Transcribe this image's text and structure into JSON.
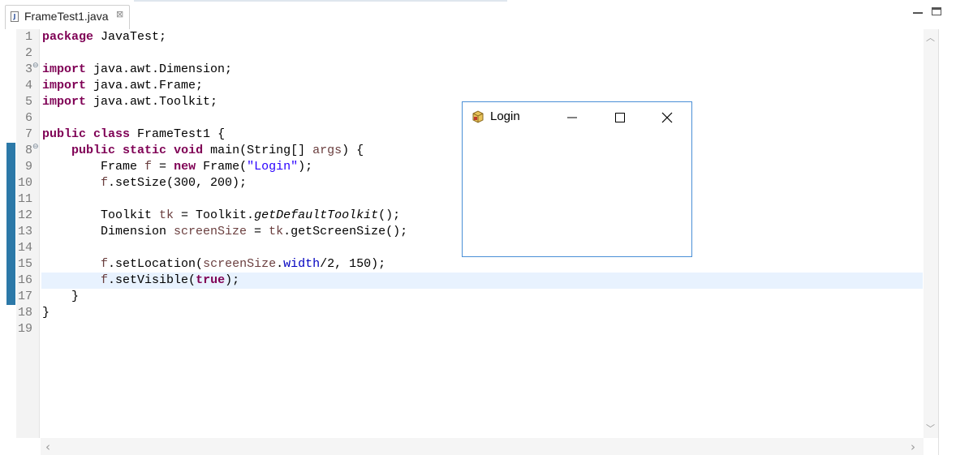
{
  "tab": {
    "title": "FrameTest1.java",
    "file_icon": "J",
    "close_glyph": "⊠"
  },
  "colors": {
    "keyword": "#7f0055",
    "string": "#2a00ff",
    "field": "#0000c0",
    "local_var": "#6a3e3e",
    "change_bar": "#2c79a8",
    "current_line": "#e8f2fe",
    "frame_border": "#4a8fd6"
  },
  "code": {
    "lines": [
      {
        "n": "1",
        "fold": "",
        "tokens": [
          [
            "kw",
            "package"
          ],
          [
            "p",
            " JavaTest;"
          ]
        ]
      },
      {
        "n": "2",
        "fold": "",
        "tokens": []
      },
      {
        "n": "3",
        "fold": "⊖",
        "tokens": [
          [
            "kw",
            "import"
          ],
          [
            "p",
            " java.awt.Dimension;"
          ]
        ]
      },
      {
        "n": "4",
        "fold": "",
        "tokens": [
          [
            "kw",
            "import"
          ],
          [
            "p",
            " java.awt.Frame;"
          ]
        ]
      },
      {
        "n": "5",
        "fold": "",
        "tokens": [
          [
            "kw",
            "import"
          ],
          [
            "p",
            " java.awt.Toolkit;"
          ]
        ]
      },
      {
        "n": "6",
        "fold": "",
        "tokens": []
      },
      {
        "n": "7",
        "fold": "",
        "tokens": [
          [
            "kw",
            "public"
          ],
          [
            "p",
            " "
          ],
          [
            "kw",
            "class"
          ],
          [
            "p",
            " FrameTest1 {"
          ]
        ]
      },
      {
        "n": "8",
        "fold": "⊖",
        "tokens": [
          [
            "p",
            "    "
          ],
          [
            "kw",
            "public"
          ],
          [
            "p",
            " "
          ],
          [
            "kw",
            "static"
          ],
          [
            "p",
            " "
          ],
          [
            "kw",
            "void"
          ],
          [
            "p",
            " main(String[] "
          ],
          [
            "var",
            "args"
          ],
          [
            "p",
            ") {"
          ]
        ]
      },
      {
        "n": "9",
        "fold": "",
        "tokens": [
          [
            "p",
            "        Frame "
          ],
          [
            "var",
            "f"
          ],
          [
            "p",
            " = "
          ],
          [
            "kw",
            "new"
          ],
          [
            "p",
            " Frame("
          ],
          [
            "str",
            "\"Login\""
          ],
          [
            "p",
            ");"
          ]
        ]
      },
      {
        "n": "10",
        "fold": "",
        "tokens": [
          [
            "p",
            "        "
          ],
          [
            "var",
            "f"
          ],
          [
            "p",
            ".setSize(300, 200);"
          ]
        ]
      },
      {
        "n": "11",
        "fold": "",
        "tokens": []
      },
      {
        "n": "12",
        "fold": "",
        "tokens": [
          [
            "p",
            "        Toolkit "
          ],
          [
            "var",
            "tk"
          ],
          [
            "p",
            " = Toolkit."
          ],
          [
            "stat",
            "getDefaultToolkit"
          ],
          [
            "p",
            "();"
          ]
        ]
      },
      {
        "n": "13",
        "fold": "",
        "tokens": [
          [
            "p",
            "        Dimension "
          ],
          [
            "var",
            "screenSize"
          ],
          [
            "p",
            " = "
          ],
          [
            "var",
            "tk"
          ],
          [
            "p",
            ".getScreenSize();"
          ]
        ]
      },
      {
        "n": "14",
        "fold": "",
        "tokens": []
      },
      {
        "n": "15",
        "fold": "",
        "tokens": [
          [
            "p",
            "        "
          ],
          [
            "var",
            "f"
          ],
          [
            "p",
            ".setLocation("
          ],
          [
            "var",
            "screenSize"
          ],
          [
            "p",
            "."
          ],
          [
            "fld",
            "width"
          ],
          [
            "p",
            "/2, 150);"
          ]
        ]
      },
      {
        "n": "16",
        "fold": "",
        "tokens": [
          [
            "p",
            "        "
          ],
          [
            "var",
            "f"
          ],
          [
            "p",
            ".setVisible("
          ],
          [
            "kw",
            "true"
          ],
          [
            "p",
            ");"
          ]
        ]
      },
      {
        "n": "17",
        "fold": "",
        "tokens": [
          [
            "p",
            "    }"
          ]
        ]
      },
      {
        "n": "18",
        "fold": "",
        "tokens": [
          [
            "p",
            "}"
          ]
        ]
      },
      {
        "n": "19",
        "fold": "",
        "tokens": []
      }
    ]
  },
  "frame_window": {
    "title": "Login",
    "minimize_icon": "minimize-icon",
    "maximize_icon": "maximize-icon",
    "close_icon": "close-icon"
  },
  "scrollbars": {
    "up": "︿",
    "down": "﹀",
    "left": "‹",
    "right": "›"
  }
}
